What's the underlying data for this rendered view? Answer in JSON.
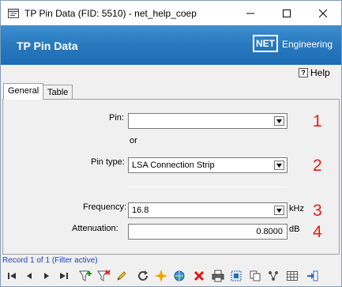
{
  "window": {
    "title": "TP Pin Data (FID: 5510) - net_help_coep"
  },
  "banner": {
    "title": "TP Pin Data",
    "brand_mark": "NET",
    "brand_text": "Engineering"
  },
  "help": {
    "label": "Help",
    "icon_glyph": "?"
  },
  "tabs": [
    {
      "label": "General",
      "active": true
    },
    {
      "label": "Table",
      "active": false
    }
  ],
  "form": {
    "pin": {
      "label": "Pin:",
      "value": "",
      "marker": "1"
    },
    "or_text": "or",
    "pin_type": {
      "label": "Pin type:",
      "value": "LSA Connection Strip",
      "marker": "2"
    },
    "frequency": {
      "label": "Frequency:",
      "value": "16.8",
      "unit": "kHz",
      "marker": "3"
    },
    "attenuation": {
      "label": "Attenuation:",
      "value": "0.8000",
      "unit": "dB",
      "marker": "4"
    }
  },
  "status": {
    "record_text": "Record 1 of 1 (Filter active)"
  },
  "colors": {
    "banner": "#2a7ac0",
    "marker": "#e02020",
    "status_text": "#1d3fbf"
  }
}
